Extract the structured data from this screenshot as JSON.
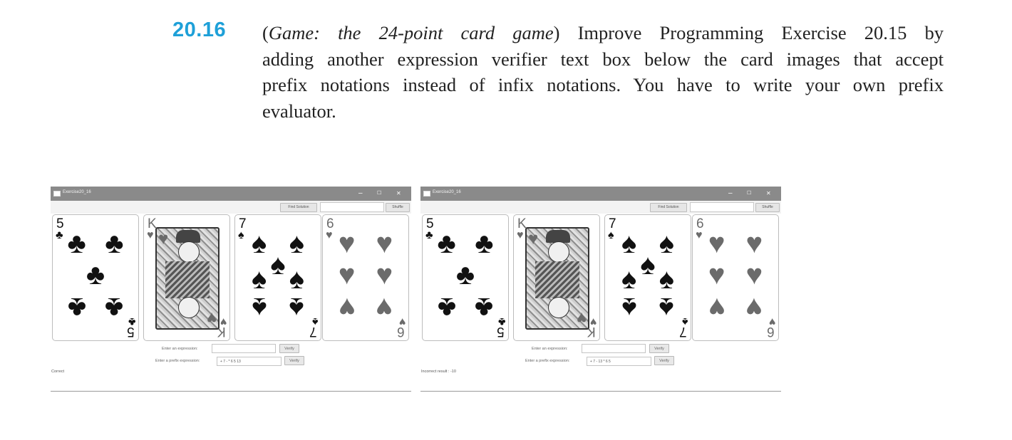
{
  "exercise": {
    "number": "20.16",
    "lines": [
      [
        "(",
        "Game: the 24-point card game",
        ") Improve Programming Exercise 20.15 by"
      ],
      [
        "adding another expression verifier text box below the card images that accept"
      ],
      [
        "prefix notations instead of infix notations. You have to write your own prefix"
      ],
      [
        "evaluator."
      ]
    ]
  },
  "windows": [
    {
      "title": "Exercise20_16",
      "find_label": "Find Solution",
      "shuffle_label": "Shuffle",
      "minimize": "–",
      "maximize": "☐",
      "close": "✕",
      "cards": [
        {
          "rank": "5",
          "suit": "♣",
          "color": "black"
        },
        {
          "rank": "K",
          "suit": "♥",
          "color": "grey"
        },
        {
          "rank": "7",
          "suit": "♠",
          "color": "black"
        },
        {
          "rank": "6",
          "suit": "♥",
          "color": "grey"
        }
      ],
      "expr_label": "Enter an expression:",
      "expr_value": "",
      "verify_label": "Verify",
      "prefix_label": "Enter a prefix expression:",
      "prefix_value": "+ 7 - * 6 5 13",
      "verify2_label": "Verify",
      "status": "Correct"
    },
    {
      "title": "Exercise20_16",
      "find_label": "Find Solution",
      "shuffle_label": "Shuffle",
      "minimize": "–",
      "maximize": "☐",
      "close": "✕",
      "cards": [
        {
          "rank": "5",
          "suit": "♣",
          "color": "black"
        },
        {
          "rank": "K",
          "suit": "♥",
          "color": "grey"
        },
        {
          "rank": "7",
          "suit": "♠",
          "color": "black"
        },
        {
          "rank": "6",
          "suit": "♥",
          "color": "grey"
        }
      ],
      "expr_label": "Enter an expression:",
      "expr_value": "",
      "verify_label": "Verify",
      "prefix_label": "Enter a prefix expression:",
      "prefix_value": "+ 7 - 13 * 6 5",
      "verify2_label": "Verify",
      "status": "Incorrect result : -10"
    }
  ]
}
